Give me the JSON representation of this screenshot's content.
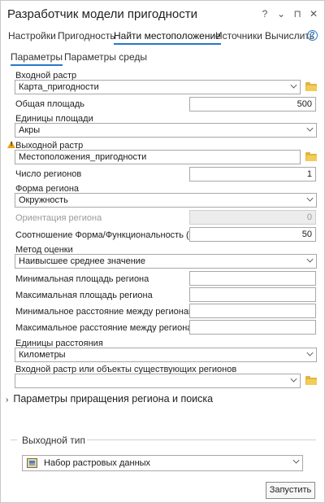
{
  "window": {
    "title": "Разработчик модели пригодности",
    "help_glyph": "?",
    "menu_glyph": "⌄",
    "pin_glyph": "⊓",
    "close_glyph": "✕"
  },
  "tabs": [
    {
      "label": "Настройки"
    },
    {
      "label": "Пригодность"
    },
    {
      "label": "Найти местоположение"
    },
    {
      "label": "Источники"
    },
    {
      "label": "Вычислить"
    }
  ],
  "subtabs": [
    {
      "label": "Параметры"
    },
    {
      "label": "Параметры среды"
    }
  ],
  "form": {
    "input_raster": {
      "label": "Входной растр",
      "value": "Карта_пригодности"
    },
    "total_area": {
      "label": "Общая площадь",
      "value": "500"
    },
    "area_units": {
      "label": "Единицы площади",
      "value": "Акры"
    },
    "output_raster": {
      "label": "Выходной растр",
      "value": "Местоположения_пригодности"
    },
    "num_regions": {
      "label": "Число регионов",
      "value": "1"
    },
    "region_shape": {
      "label": "Форма региона",
      "value": "Окружность"
    },
    "region_orientation": {
      "label": "Ориентация региона",
      "value": "0"
    },
    "shape_ratio": {
      "label": "Соотношение Форма/Функциональность (%)",
      "value": "50"
    },
    "eval_method": {
      "label": "Метод оценки",
      "value": "Наивысшее среднее значение"
    },
    "min_region_area": {
      "label": "Минимальная площадь региона",
      "value": ""
    },
    "max_region_area": {
      "label": "Максимальная площадь региона",
      "value": ""
    },
    "min_region_distance": {
      "label": "Минимальное расстояние между регионами",
      "value": ""
    },
    "max_region_distance": {
      "label": "Максимальное расстояние между регионами",
      "value": ""
    },
    "distance_units": {
      "label": "Единицы расстояния",
      "value": "Километры"
    },
    "existing_regions": {
      "label": "Входной растр или объекты существующих регионов",
      "value": ""
    }
  },
  "sections": {
    "growth_params": {
      "label": "Параметры приращения региона и поиска",
      "arrow": "›"
    }
  },
  "output": {
    "title": "Выходной тип",
    "type_value": "Набор растровых данных"
  },
  "buttons": {
    "run": "Запустить"
  },
  "colors": {
    "accent": "#2a78c7",
    "warning": "#e8a317",
    "folder": "#e4b43a"
  }
}
